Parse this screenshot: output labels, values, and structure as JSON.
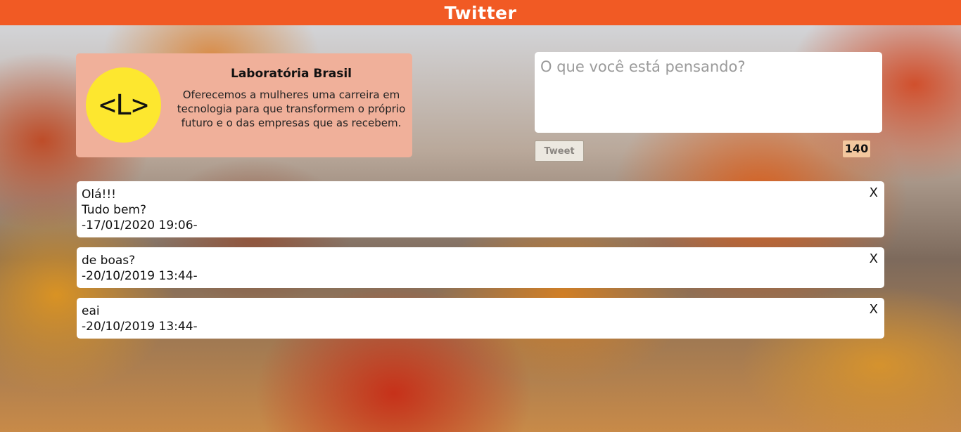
{
  "header": {
    "title": "Twitter"
  },
  "profile": {
    "logo_text": "<L>",
    "name": "Laboratória Brasil",
    "description_lines": [
      "Oferecemos a mulheres uma carreira em",
      "tecnologia para que transformem o próprio",
      "futuro e o das empresas que as recebem."
    ]
  },
  "composer": {
    "placeholder": "O que você está pensando?",
    "button_label": "Tweet",
    "char_count": "140"
  },
  "tweets": [
    {
      "lines": [
        "Olá!!!",
        "Tudo bem?"
      ],
      "timestamp": "-17/01/2020 19:06-",
      "close": "X"
    },
    {
      "lines": [
        "de boas?"
      ],
      "timestamp": "-20/10/2019 13:44-",
      "close": "X"
    },
    {
      "lines": [
        "eai"
      ],
      "timestamp": "-20/10/2019 13:44-",
      "close": "X"
    }
  ],
  "colors": {
    "header_bg": "#f15a24",
    "profile_bg": "#f0b09a",
    "logo_bg": "#fde72f",
    "counter_bg": "#f3c79e"
  }
}
